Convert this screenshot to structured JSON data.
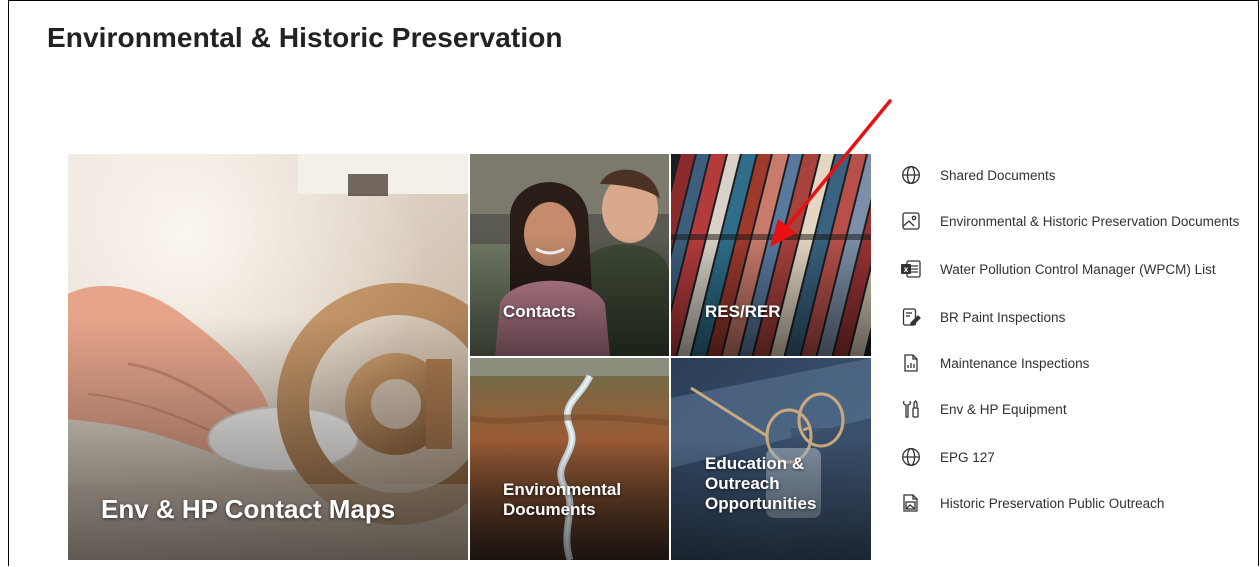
{
  "page": {
    "title": "Environmental & Historic Preservation"
  },
  "tiles": [
    {
      "label_lines": [
        "Env & HP Contact Maps"
      ]
    },
    {
      "label_lines": [
        "Contacts"
      ]
    },
    {
      "label_lines": [
        "RES/RER"
      ]
    },
    {
      "label_lines": [
        "Environmental",
        "Documents"
      ]
    },
    {
      "label_lines": [
        "Education &",
        "Outreach",
        "Opportunities"
      ]
    }
  ],
  "quick_links": [
    {
      "label": "Shared Documents",
      "icon": "globe-icon"
    },
    {
      "label": "Environmental & Historic Preservation Documents",
      "icon": "image-file-icon"
    },
    {
      "label": "Water Pollution Control Manager (WPCM) List",
      "icon": "excel-icon"
    },
    {
      "label": "BR Paint Inspections",
      "icon": "form-edit-icon"
    },
    {
      "label": "Maintenance Inspections",
      "icon": "report-chart-icon"
    },
    {
      "label": "Env & HP Equipment",
      "icon": "tools-icon"
    },
    {
      "label": "EPG 127",
      "icon": "globe-icon"
    },
    {
      "label": "Historic Preservation Public Outreach",
      "icon": "picture-doc-icon"
    }
  ],
  "annotation": {
    "arrow_color": "#e81010"
  }
}
